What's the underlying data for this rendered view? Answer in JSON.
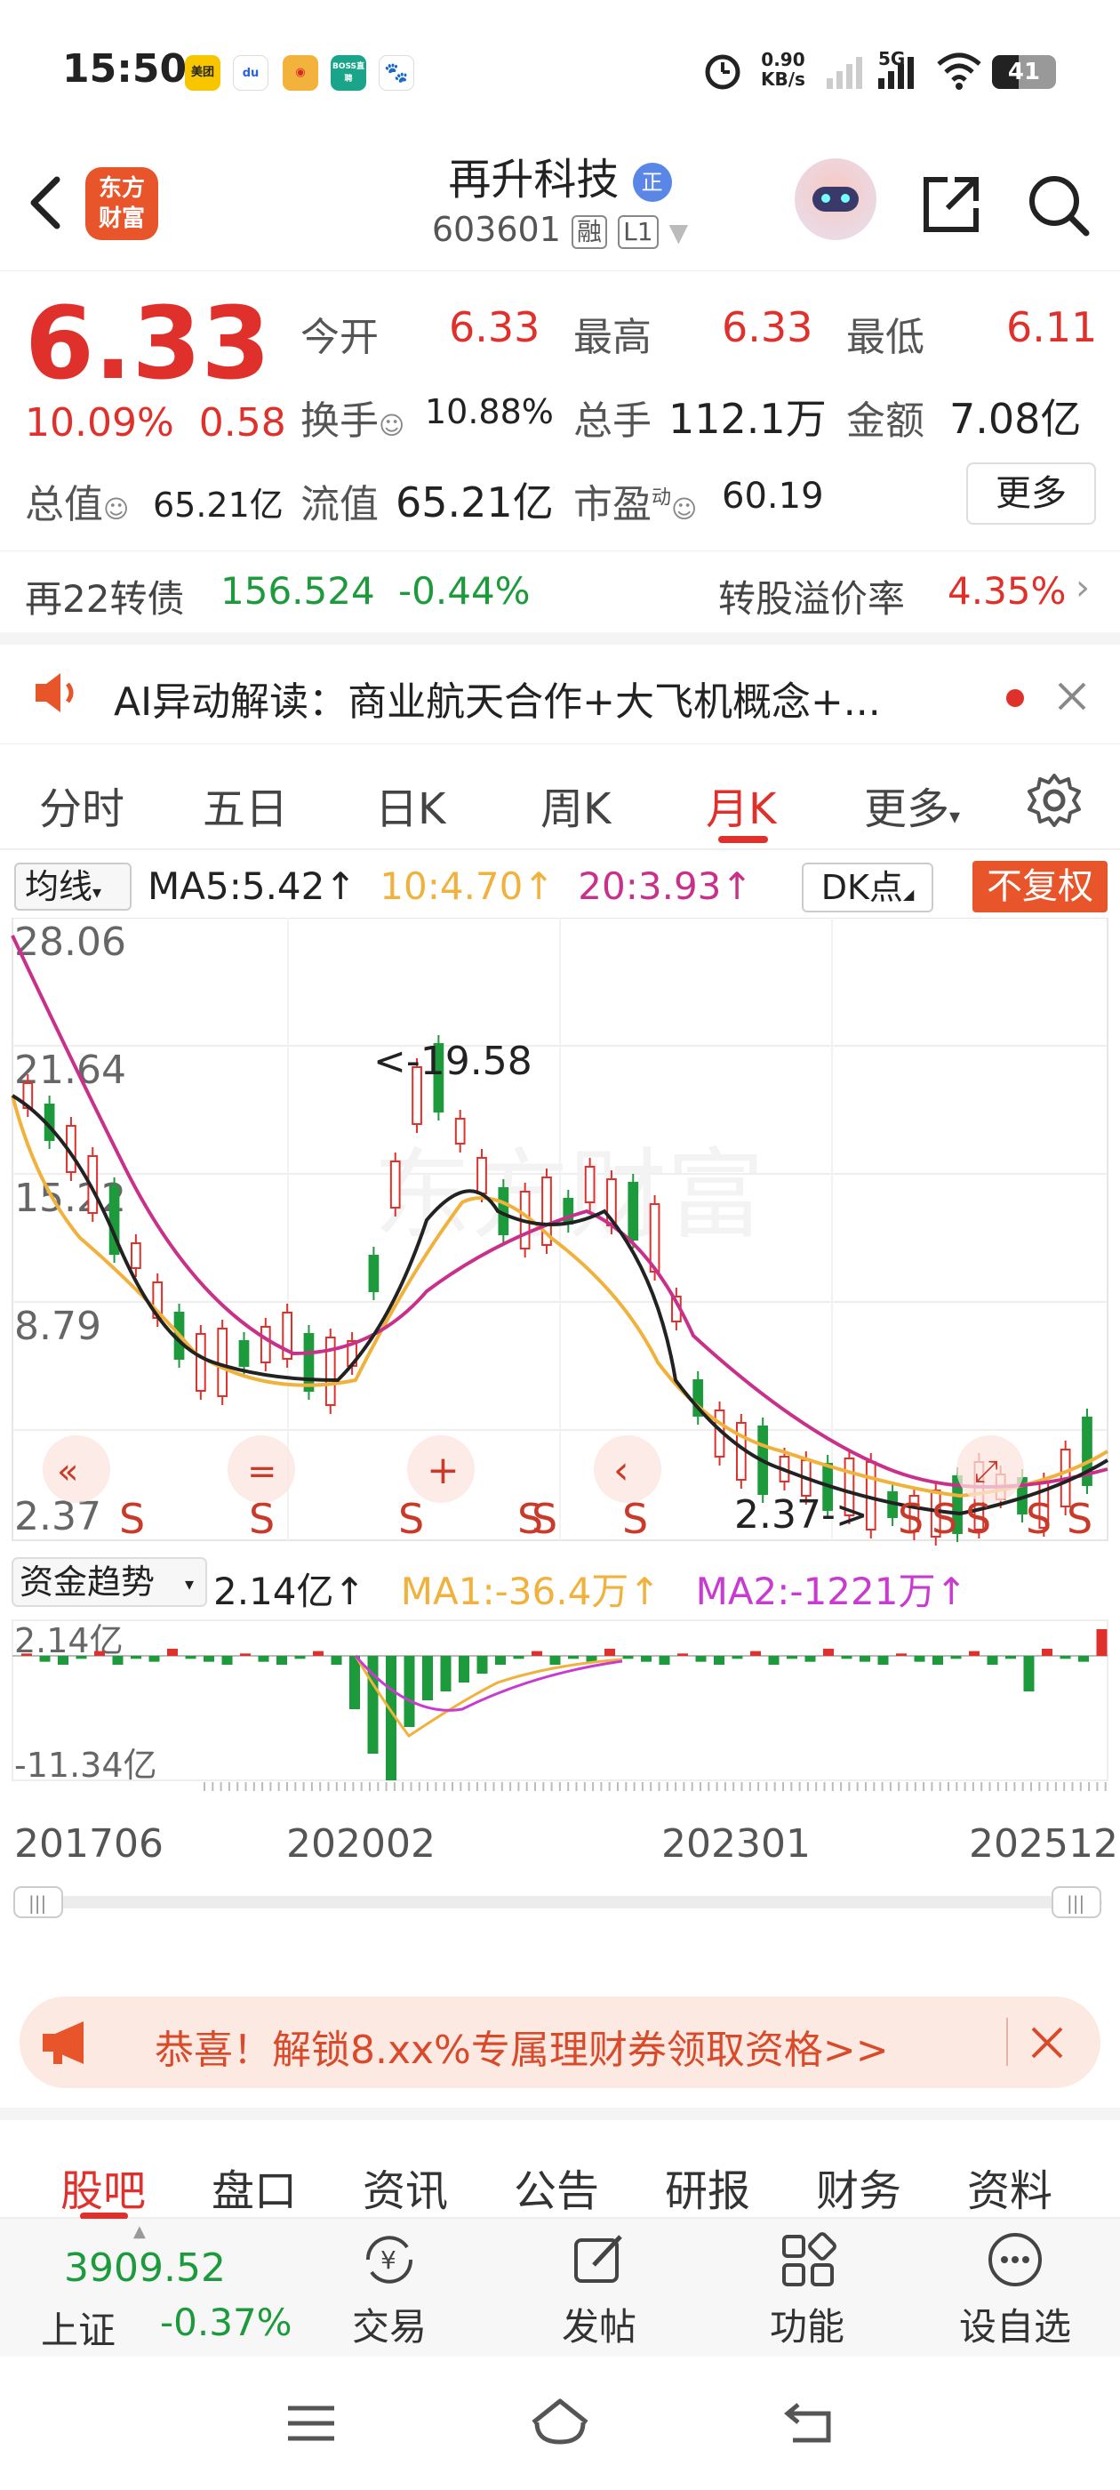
{
  "status_bar": {
    "time": "15:50",
    "apps": [
      "美团",
      "du",
      "微博",
      "BOSS直聘",
      "百度"
    ],
    "net_speed_value": "0.90",
    "net_speed_unit": "KB/s",
    "network": "5G",
    "battery": "41"
  },
  "header": {
    "logo_line1": "东方",
    "logo_line2": "财富",
    "stock_name": "再升科技",
    "name_badge": "正",
    "stock_code": "603601",
    "tag_margin": "融",
    "tag_level": "L1"
  },
  "quote": {
    "price": "6.33",
    "change_pct": "10.09%",
    "change_abs": "0.58",
    "open_label": "今开",
    "open_value": "6.33",
    "high_label": "最高",
    "high_value": "6.33",
    "low_label": "最低",
    "low_value": "6.11",
    "turnover_label": "换手",
    "turnover_value": "10.88%",
    "volume_label": "总手",
    "volume_value": "112.1万",
    "amount_label": "金额",
    "amount_value": "7.08亿",
    "mktcap_label": "总值",
    "mktcap_value": "65.21亿",
    "float_label": "流值",
    "float_value": "65.21亿",
    "pe_label": "市盈",
    "pe_sup": "动",
    "pe_value": "60.19",
    "more_button": "更多"
  },
  "bond": {
    "name": "再22转债",
    "price": "156.524",
    "change": "-0.44%",
    "premium_label": "转股溢价率",
    "premium_value": "4.35%"
  },
  "ai_banner": {
    "text": "AI异动解读：商业航天合作+大飞机概念+..."
  },
  "chart_tabs": [
    "分时",
    "五日",
    "日K",
    "周K",
    "月K",
    "更多"
  ],
  "chart_legend": {
    "indicator_select": "均线",
    "ma5": "MA5:5.42",
    "ma10": "10:4.70",
    "ma20": "20:3.93",
    "dk_button": "DK点",
    "adjust_button": "不复权",
    "arrow": "↑"
  },
  "flow_legend": {
    "indicator_select": "资金趋势",
    "value": "2.14亿",
    "ma1": "MA1:-36.4万",
    "ma2": "MA2:-1221万",
    "arrow": "↑"
  },
  "colors": {
    "up": "#e0302b",
    "down": "#1d9a3c",
    "ma5": "#222222",
    "ma10": "#f0b23c",
    "ma20": "#c8308a",
    "accent": "#e8552a"
  },
  "chart_data": {
    "type": "candlestick",
    "title": "",
    "y_ticks": [
      "28.06",
      "21.64",
      "15.22",
      "8.79",
      "2.37"
    ],
    "ylim": [
      2.37,
      28.06
    ],
    "annotations": [
      "<-19.58",
      "2.37->"
    ],
    "x_ticks": [
      "201706",
      "202002",
      "202301",
      "202512"
    ],
    "signal_marks": [
      "S",
      "S",
      "S",
      "S",
      "S",
      "S",
      "S",
      "S",
      "S",
      "S",
      "S"
    ],
    "flow_y_ticks": [
      "2.14亿",
      "-11.34亿"
    ],
    "watermark": "东方财富"
  },
  "promo": {
    "text": "恭喜！解锁8.xx%专属理财券领取资格>>"
  },
  "bottom_tabs": [
    "股吧",
    "盘口",
    "资讯",
    "公告",
    "研报",
    "财务",
    "资料"
  ],
  "toolbar": {
    "index_value": "3909.52",
    "index_name": "上证",
    "index_change": "-0.37%",
    "trade": "交易",
    "post": "发帖",
    "functions": "功能",
    "watchlist": "设自选"
  }
}
